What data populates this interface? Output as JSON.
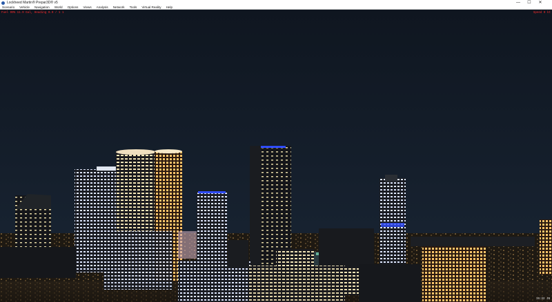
{
  "window": {
    "title": "Lockheed Martin® Prepar3D® v5",
    "controls": {
      "minimize": "—",
      "maximize": "☐",
      "close": "✕"
    }
  },
  "menu": {
    "items": [
      "Scenario",
      "Vehicle",
      "Navigation",
      "World",
      "Options",
      "Views",
      "Analysis",
      "Network",
      "Tools",
      "Virtual Reality",
      "Help"
    ]
  },
  "hud": {
    "left": "Fuel 99%   11.9 Gal, Heading 0.0 / 1 1",
    "right": "Speed 0 kt"
  },
  "clock": "19:32 JN",
  "colors": {
    "sky_top": "#0f1620",
    "sky_bottom": "#1a2533",
    "hud_text": "#ff2a2a",
    "window_light": "#f3e6b8",
    "window_cool": "#dfe8ff",
    "accent_blue": "#2f4cff"
  }
}
